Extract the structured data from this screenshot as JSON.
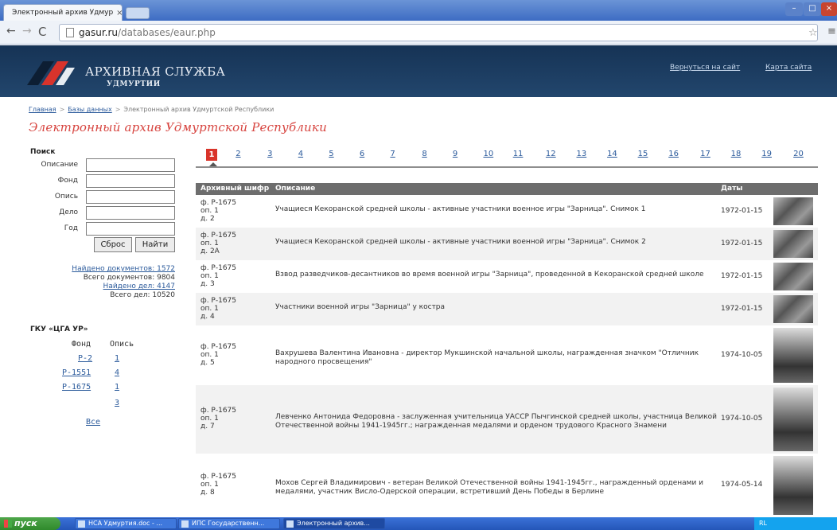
{
  "browser": {
    "tab_title": "Электронный архив Удмур",
    "tab_close": "×",
    "url_host": "gasur.ru",
    "url_path": "/databases/eaur.php",
    "window_min": "–",
    "window_max": "□",
    "window_close": "×"
  },
  "header": {
    "org_name": "АРХИВНАЯ СЛУЖБА",
    "org_sub": "УДМУРТИИ",
    "back_link": "Вернуться на сайт",
    "sitemap_link": "Карта сайта"
  },
  "breadcrumb": {
    "items": [
      "Главная",
      "Базы данных"
    ],
    "current": "Электронный архив Удмуртской Республики",
    "separator": ">"
  },
  "page_title": "Электронный архив Удмуртской Республики",
  "search": {
    "heading": "Поиск",
    "fields": [
      {
        "label": "Описание",
        "value": ""
      },
      {
        "label": "Фонд",
        "value": ""
      },
      {
        "label": "Опись",
        "value": ""
      },
      {
        "label": "Дело",
        "value": ""
      },
      {
        "label": "Год",
        "value": ""
      }
    ],
    "reset_label": "Сброс",
    "find_label": "Найти"
  },
  "stats": {
    "found_docs": "Найдено документов: 1572",
    "total_docs": "Всего документов: 9804",
    "found_cases": "Найдено дел: 4147",
    "total_cases": "Всего дел: 10520"
  },
  "funds": {
    "heading": "ГКУ «ЦГА УР»",
    "col_fond": "Фонд",
    "col_opis": "Опись",
    "fonds": [
      "Р-2",
      "Р-1551",
      "Р-1675"
    ],
    "opisi": [
      "1",
      "4",
      "1",
      "3"
    ],
    "all_label": "Все"
  },
  "pagination": {
    "pages": [
      "1",
      "2",
      "3",
      "4",
      "5",
      "6",
      "7",
      "8",
      "9",
      "10",
      "11",
      "12",
      "13",
      "14",
      "15",
      "16",
      "17",
      "18",
      "19",
      "20"
    ],
    "active": "1"
  },
  "results": {
    "columns": {
      "code": "Архивный шифр",
      "desc": "Описание",
      "date": "Даты"
    },
    "rows": [
      {
        "code": "ф. Р-1675\nоп. 1\nд. 2",
        "desc": "Учащиеся Кекоранской средней школы - активные участники военное игры \"Зарница\". Снимок 1",
        "date": "1972-01-15"
      },
      {
        "code": "ф. Р-1675\nоп. 1\nд. 2А",
        "desc": "Учащиеся Кекоранской средней школы - активные участники военной игры \"Зарница\". Снимок 2",
        "date": "1972-01-15"
      },
      {
        "code": "ф. Р-1675\nоп. 1\nд. 3",
        "desc": "Взвод разведчиков-десантников во время военной игры \"Зарница\", проведенной в Кекоранской средней школе",
        "date": "1972-01-15"
      },
      {
        "code": "ф. Р-1675\nоп. 1\nд. 4",
        "desc": "Участники военной игры \"Зарница\" у костра",
        "date": "1972-01-15"
      },
      {
        "code": "ф. Р-1675\nоп. 1\nд. 5",
        "desc": "Вахрушева Валентина Ивановна - директор Мукшинской начальной школы, награжденная значком \"Отличник народного просвещения\"",
        "date": "1974-10-05"
      },
      {
        "code": "ф. Р-1675\nоп. 1\nд. 7",
        "desc": "Левченко Антонида Федоровна - заслуженная учительница УАССР Пычгинской средней школы, участница Великой Отечественной войны 1941-1945гг.; награжденная медалями и орденом трудового Красного Знамени",
        "date": "1974-10-05"
      },
      {
        "code": "ф. Р-1675\nоп. 1\nд. 8",
        "desc": "Мохов Сергей Владимирович - ветеран Великой Отечественной войны 1941-1945гг., награжденный орденами и медалями, участник Висло-Одерской операции, встретивший День Победы в Берлине",
        "date": "1974-05-14"
      }
    ]
  },
  "taskbar": {
    "start_label": "пуск",
    "tasks": [
      "НСА Удмуртия.doc - ...",
      "ИПС Государственн...",
      "Электронный архив..."
    ],
    "tray": "RL"
  }
}
